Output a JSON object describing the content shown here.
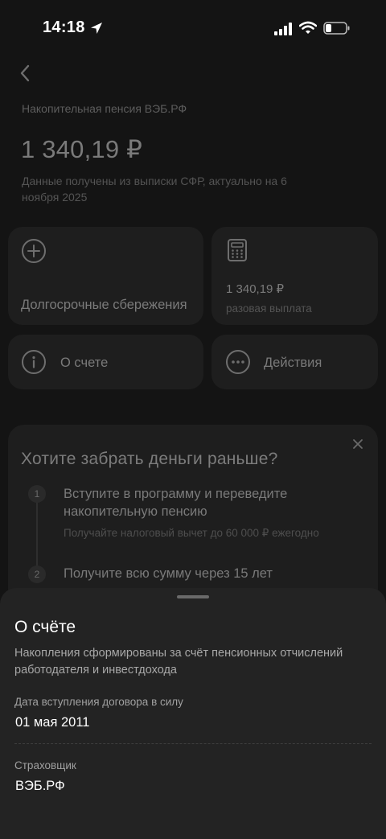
{
  "status_bar": {
    "time": "14:18",
    "icons": [
      "location-arrow-icon",
      "signal-icon",
      "wifi-icon",
      "battery-icon"
    ]
  },
  "header": {
    "back_icon": "chevron-left-icon"
  },
  "account": {
    "name": "Накопительная пенсия ВЭБ.РФ",
    "balance": "1 340,19 ₽",
    "note": "Данные получены из выписки СФР, актуально на 6 ноября 2025"
  },
  "tiles": {
    "savings": {
      "label": "Долгосрочные сбережения",
      "icon": "plus-circle-icon"
    },
    "payout": {
      "amount": "1 340,19 ₽",
      "label": "разовая выплата",
      "icon": "calculator-icon"
    },
    "about": {
      "label": "О счете",
      "icon": "info-icon"
    },
    "actions": {
      "label": "Действия",
      "icon": "more-dots-icon"
    }
  },
  "promo": {
    "title": "Хотите забрать деньги раньше?",
    "steps": [
      {
        "num": "1",
        "title": "Вступите в программу и переведите накопительную пенсию",
        "subtitle": "Получайте налоговый вычет до 60 000 ₽ ежегодно"
      },
      {
        "num": "2",
        "title": "Получите всю сумму через 15 лет"
      }
    ]
  },
  "sheet": {
    "title": "О счёте",
    "description": "Накопления сформированы за счёт пенсионных отчислений работодателя и инвестдохода",
    "fields": [
      {
        "label": "Дата вступления договора в силу",
        "value": "01 мая 2011"
      },
      {
        "label": "Страховщик",
        "value": "ВЭБ.РФ"
      }
    ]
  },
  "colors": {
    "background": "#141414",
    "tile": "#1e1e1e",
    "sheet": "#232323",
    "text_primary": "#ffffff",
    "text_secondary": "#a8a8a8"
  }
}
